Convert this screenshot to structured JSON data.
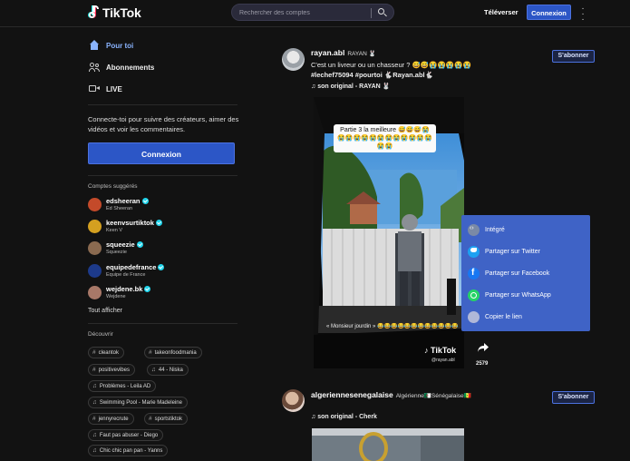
{
  "header": {
    "logo_text": "TikTok",
    "search_placeholder": "Rechercher des comptes",
    "upload_label": "Téléverser",
    "login_label": "Connexion",
    "more_icon": "vertical-dots-icon"
  },
  "sidebar": {
    "nav": [
      {
        "label": "Pour toi",
        "icon": "home-icon"
      },
      {
        "label": "Abonnements",
        "icon": "users-icon"
      },
      {
        "label": "LIVE",
        "icon": "live-camera-icon"
      }
    ],
    "connect_text": "Connecte-toi pour suivre des créateurs, aimer des vidéos et voir les commentaires.",
    "login_label": "Connexion",
    "suggested_title": "Comptes suggérés",
    "accounts": [
      {
        "username": "edsheeran",
        "name": "Ed Sheeran",
        "color": "#c44a2a"
      },
      {
        "username": "keenvsurtiktok",
        "name": "Keen V",
        "color": "#d4a020"
      },
      {
        "username": "squeezie",
        "name": "Squeezie",
        "color": "#8a6a50"
      },
      {
        "username": "equipedefrance",
        "name": "Equipe de France",
        "color": "#1d3a8a"
      },
      {
        "username": "wejdene.bk",
        "name": "Wejdene",
        "color": "#a87868"
      }
    ],
    "show_all": "Tout afficher",
    "discover_title": "Découvrir",
    "tags": [
      {
        "label": "cleantok",
        "icon": "#"
      },
      {
        "label": "takeonfoodmania",
        "icon": "#"
      },
      {
        "label": "positivevibes",
        "icon": "#"
      },
      {
        "label": "44 - Niska",
        "icon": "♫"
      },
      {
        "label": "Problèmes - Leila AD",
        "icon": "♫"
      },
      {
        "label": "Swimming Pool - Marie Madeleine",
        "icon": "♫"
      },
      {
        "label": "jennyrecrute",
        "icon": "#"
      },
      {
        "label": "sportstiktok",
        "icon": "#"
      },
      {
        "label": "Faut pas abuser - Diego",
        "icon": "♫"
      },
      {
        "label": "Chic chic pan pan - Yanns",
        "icon": "♫"
      }
    ]
  },
  "feed": {
    "post1": {
      "username": "rayan.abl",
      "display_name": "RAYAN 🐰",
      "caption_line1": "C'est un livreur ou un chasseur ? 😅😅😭😭😭😭😭",
      "caption_line2": "#lechef75094 #pourtoi 🐇Rayan.abl🐇",
      "music": "son original - RAYAN 🐰",
      "subscribe_label": "S'abonner",
      "overlay_text": "Partie 3 la meilleure 😅😅😅😭😭😭😭😭😭😭😭😭😭😭😭😭😭😭",
      "video_caption": "« Monsieur jourdin » 😂😂😂😂😂😂😂😂😂😂😂😂",
      "watermark": "TikTok",
      "watermark_handle": "@rayan.abl",
      "share_count": "2579"
    },
    "share_menu": [
      {
        "label": "Intégré",
        "icon": "embed-icon",
        "color": "#7a8aa6"
      },
      {
        "label": "Partager sur Twitter",
        "icon": "twitter-icon",
        "color": "#1da1f2"
      },
      {
        "label": "Partager sur Facebook",
        "icon": "facebook-icon",
        "color": "#1877f2"
      },
      {
        "label": "Partager sur WhatsApp",
        "icon": "whatsapp-icon",
        "color": "#25d366"
      },
      {
        "label": "Copier le lien",
        "icon": "link-icon",
        "color": "#b0b8d8"
      }
    ],
    "post2": {
      "username": "algeriennesenegalaise",
      "display_name": "Algérienne🇩🇿Sénégalaise🇸🇳",
      "music": "son original - Cherk",
      "subscribe_label": "S'abonner"
    }
  }
}
